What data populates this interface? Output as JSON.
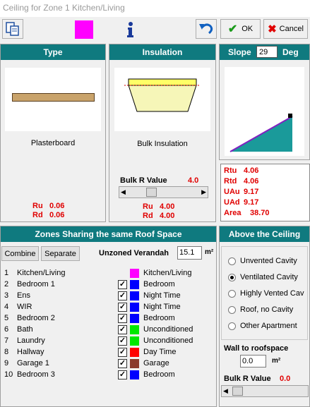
{
  "window": {
    "title": "Ceiling for Zone 1  Kitchen/Living"
  },
  "toolbar": {
    "ok_label": "OK",
    "cancel_label": "Cancel",
    "color_swatch": "#ff00ff"
  },
  "type_panel": {
    "header": "Type",
    "material": "Plasterboard",
    "ru_label": "Ru",
    "ru_value": "0.06",
    "rd_label": "Rd",
    "rd_value": "0.06"
  },
  "insulation_panel": {
    "header": "Insulation",
    "material": "Bulk Insulation",
    "bulk_r_label": "Bulk R Value",
    "bulk_r_value": "4.0",
    "ru_label": "Ru",
    "ru_value": "4.00",
    "rd_label": "Rd",
    "rd_value": "4.00"
  },
  "slope_panel": {
    "label": "Slope",
    "value": "29",
    "unit": "Deg",
    "results": [
      {
        "label": "Rtu",
        "value": "4.06"
      },
      {
        "label": "Rtd",
        "value": "4.06"
      },
      {
        "label": "UAu",
        "value": "9.17"
      },
      {
        "label": "UAd",
        "value": "9.17"
      },
      {
        "label": "Area",
        "value": "38.70"
      }
    ]
  },
  "zones_panel": {
    "header": "Zones Sharing the same Roof Space",
    "combine_label": "Combine",
    "separate_label": "Separate",
    "unzoned_label": "Unzoned Verandah",
    "unzoned_value": "15.1",
    "unzoned_unit": "m²",
    "zones": [
      {
        "num": "1",
        "name": "Kitchen/Living",
        "checked": false,
        "color": "#ff00ff",
        "type": "Kitchen/Living"
      },
      {
        "num": "2",
        "name": "Bedroom 1",
        "checked": true,
        "color": "#0000ff",
        "type": "Bedroom"
      },
      {
        "num": "3",
        "name": "Ens",
        "checked": true,
        "color": "#0000ff",
        "type": "Night Time"
      },
      {
        "num": "4",
        "name": "WIR",
        "checked": true,
        "color": "#0000ff",
        "type": "Night Time"
      },
      {
        "num": "5",
        "name": "Bedroom 2",
        "checked": true,
        "color": "#0000ff",
        "type": "Bedroom"
      },
      {
        "num": "6",
        "name": "Bath",
        "checked": true,
        "color": "#00e800",
        "type": "Unconditioned"
      },
      {
        "num": "7",
        "name": "Laundry",
        "checked": true,
        "color": "#00e800",
        "type": "Unconditioned"
      },
      {
        "num": "8",
        "name": "Hallway",
        "checked": true,
        "color": "#ff0000",
        "type": "Day Time"
      },
      {
        "num": "9",
        "name": "Garage 1",
        "checked": true,
        "color": "#8b3a2a",
        "type": "Garage"
      },
      {
        "num": "10",
        "name": "Bedroom 3",
        "checked": true,
        "color": "#0000ff",
        "type": "Bedroom"
      }
    ]
  },
  "above_panel": {
    "header": "Above the Ceiling",
    "options": [
      {
        "label": "Unvented Cavity",
        "selected": false
      },
      {
        "label": "Ventilated Cavity",
        "selected": true
      },
      {
        "label": "Highly Vented Cav",
        "selected": false
      },
      {
        "label": "Roof, no Cavity",
        "selected": false
      },
      {
        "label": "Other Apartment",
        "selected": false
      }
    ],
    "wall_label": "Wall to roofspace",
    "wall_value": "0.0",
    "wall_unit": "m²",
    "bulk_r_label": "Bulk R Value",
    "bulk_r_value": "0.0"
  }
}
